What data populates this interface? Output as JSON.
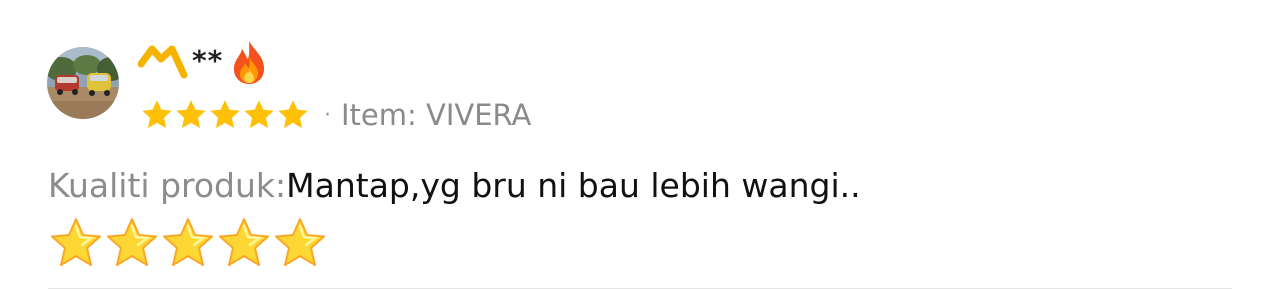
{
  "review": {
    "username": "**",
    "rating": 5,
    "separator": "·",
    "variation": "Item: VIVERA",
    "label": "Kualiti produk:",
    "content": "Mantap,yg bru ni bau lebih wangi..",
    "emoji_stars": 5,
    "icons": {
      "avatar": "avatar-photo",
      "name_mark": "chevron-mark-icon",
      "fire": "fire-icon",
      "rating_star": "star-icon",
      "emoji_star": "star-emoji-icon"
    },
    "colors": {
      "star": "#FFC107",
      "label": "#8C8C8C",
      "content": "#111111",
      "variation": "#8A8A8A"
    }
  }
}
